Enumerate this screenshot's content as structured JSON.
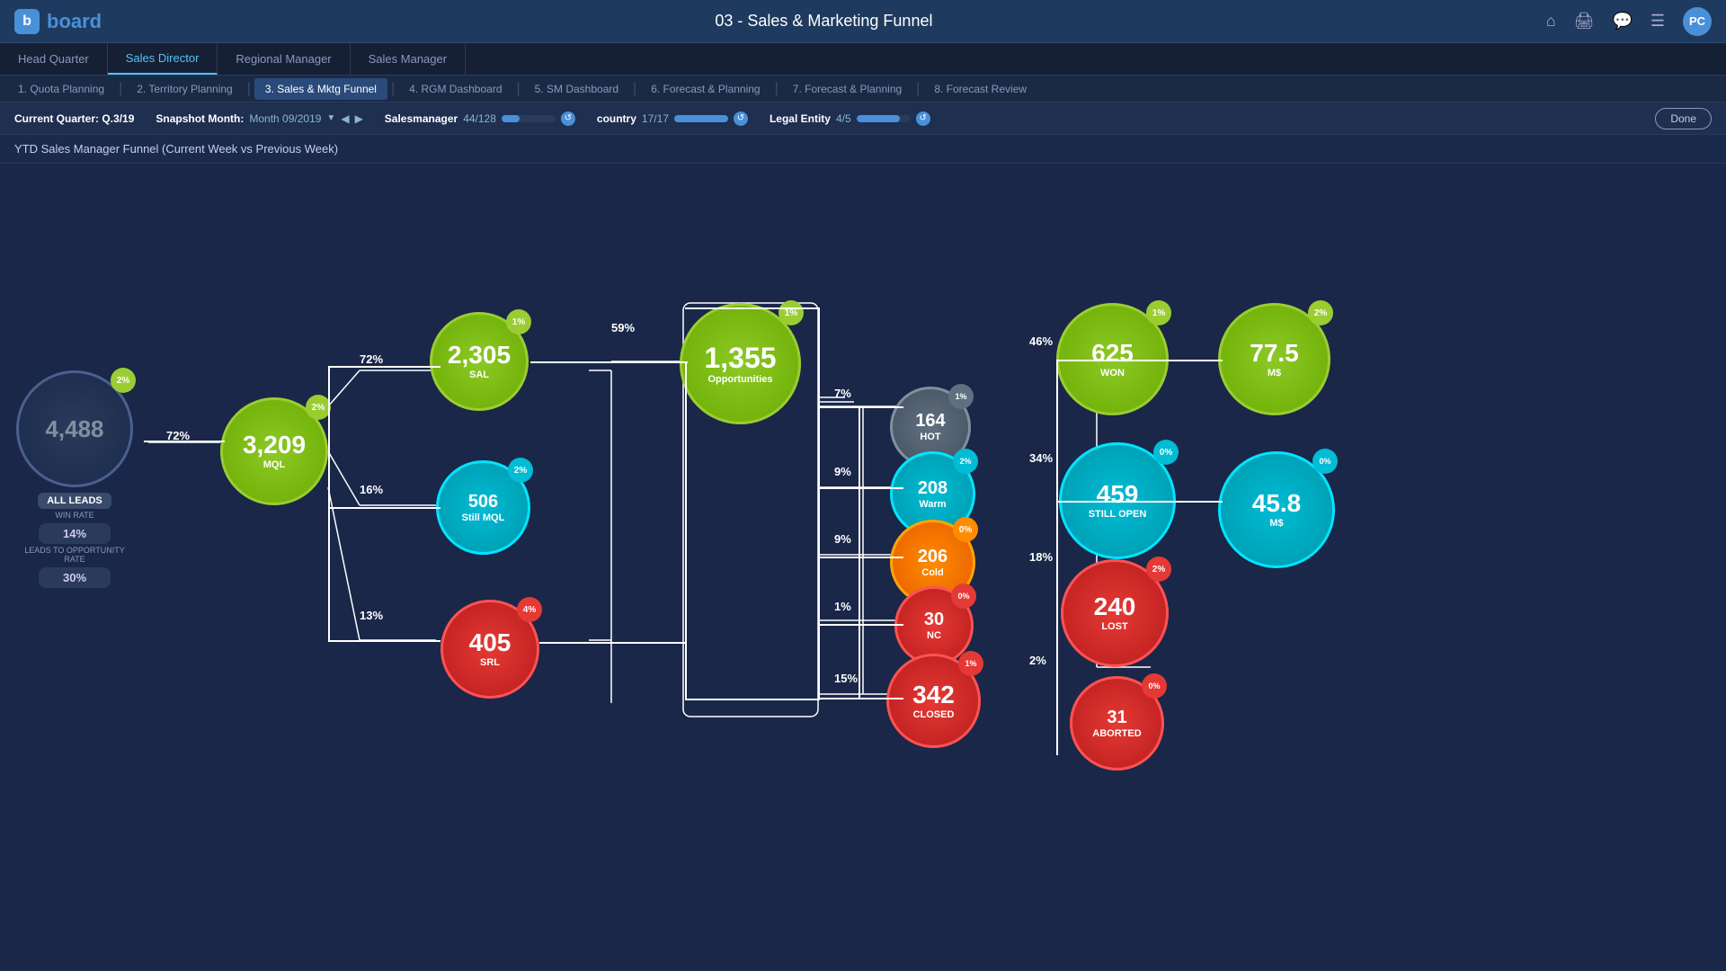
{
  "topbar": {
    "logo_b": "b",
    "logo_text": "board",
    "title": "03 - Sales & Marketing Funnel",
    "user_initials": "PC"
  },
  "nav": {
    "tabs": [
      {
        "label": "Head Quarter",
        "active": false
      },
      {
        "label": "Sales Director",
        "active": true
      },
      {
        "label": "Regional Manager",
        "active": false
      },
      {
        "label": "Sales Manager",
        "active": false
      }
    ]
  },
  "subnav": {
    "items": [
      {
        "label": "1. Quota Planning",
        "active": false
      },
      {
        "label": "2. Territory Planning",
        "active": false
      },
      {
        "label": "3. Sales & Mktg Funnel",
        "active": true
      },
      {
        "label": "4. RGM Dashboard",
        "active": false
      },
      {
        "label": "5. SM Dashboard",
        "active": false
      },
      {
        "label": "6. Forecast & Planning",
        "active": false
      },
      {
        "label": "7. Forecast & Planning",
        "active": false
      },
      {
        "label": "8. Forecast Review",
        "active": false
      }
    ]
  },
  "filterbar": {
    "quarter_label": "Current Quarter: Q.3/19",
    "snapshot_label": "Snapshot Month:",
    "snapshot_value": "Month 09/2019",
    "salesmanager_label": "Salesmanager",
    "salesmanager_value": "44/128",
    "salesmanager_pct": 34,
    "country_label": "country",
    "country_value": "17/17",
    "country_pct": 100,
    "legal_label": "Legal Entity",
    "legal_value": "4/5",
    "legal_pct": 80,
    "done_label": "Done"
  },
  "chart": {
    "title": "YTD Sales Manager Funnel (Current Week vs Previous Week)",
    "nodes": {
      "all_leads": {
        "value": "4,488",
        "label": "ALL LEADS",
        "badge": "2%",
        "win_rate_label": "WIN RATE",
        "win_rate": "14%",
        "leads_label": "LEADS TO OPPORTUNITY RATE",
        "leads_value": "30%"
      },
      "mql": {
        "value": "3,209",
        "label": "MQL",
        "badge": "2%"
      },
      "sal": {
        "value": "2,305",
        "label": "SAL",
        "badge": "1%"
      },
      "still_mql": {
        "value": "506",
        "label": "Still MQL",
        "badge": "2%"
      },
      "srl": {
        "value": "405",
        "label": "SRL",
        "badge": "4%"
      },
      "opportunities": {
        "value": "1,355",
        "label": "Opportunities",
        "badge": "1%"
      },
      "hot": {
        "value": "164",
        "label": "HOT",
        "badge": "1%"
      },
      "warm": {
        "value": "208",
        "label": "Warm",
        "badge": "2%"
      },
      "cold": {
        "value": "206",
        "label": "Cold",
        "badge": "0%"
      },
      "nc": {
        "value": "30",
        "label": "NC",
        "badge": "0%"
      },
      "closed": {
        "value": "342",
        "label": "CLOSED",
        "badge": "1%"
      },
      "won": {
        "value": "625",
        "label": "WON",
        "badge": "1%"
      },
      "still_open": {
        "value": "459",
        "label": "STILL OPEN",
        "badge": "0%"
      },
      "lost": {
        "value": "240",
        "label": "LOST",
        "badge": "2%"
      },
      "aborted": {
        "value": "31",
        "label": "ABORTED",
        "badge": "0%"
      },
      "won_ms": {
        "value": "77.5",
        "label": "M$",
        "badge": "2%"
      },
      "still_open_ms": {
        "value": "45.8",
        "label": "M$",
        "badge": "0%"
      }
    },
    "pcts": {
      "leads_to_mql": "72%",
      "mql_to_sal": "72%",
      "mql_to_still": "16%",
      "mql_to_srl": "13%",
      "sal_to_opp": "59%",
      "opp_to_hot": "7%",
      "opp_to_warm": "9%",
      "opp_to_cold": "9%",
      "opp_to_nc": "1%",
      "opp_to_closed": "15%",
      "opp_to_won": "46%",
      "opp_to_still": "34%",
      "opp_to_lost": "18%",
      "opp_to_aborted": "2%"
    }
  }
}
